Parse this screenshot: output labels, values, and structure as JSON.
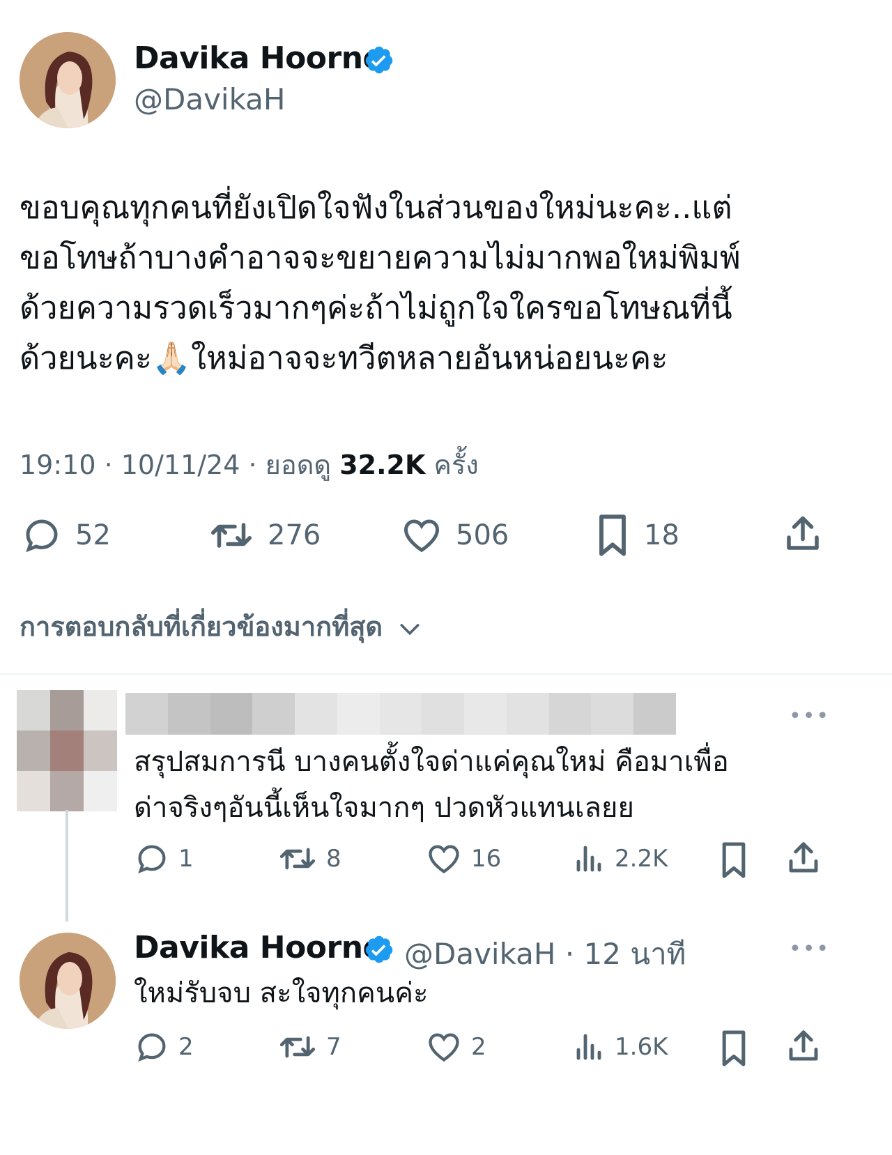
{
  "tweet": {
    "author_name": "Davika Hoorne",
    "author_handle": "@DavikaH",
    "lines": [
      "ขอบคุณทุกคนที่ยังเปิดใจฟังในส่วนของใหม่นะคะ..แต่",
      "ขอโทษถ้าบางคำอาจจะขยายความไม่มากพอใหม่พิมพ์",
      "ด้วยความรวดเร็วมากๆค่ะถ้าไม่ถูกใจใครขอโทษณที่นี้",
      "ด้วยนะคะ🙏🏻ใหม่อาจจะทวีตหลายอันหน่อยนะคะ"
    ],
    "time": "19:10 · 10/11/24 · ยอดดู ",
    "views": "32.2K",
    "views_suffix": " ครั้ง",
    "replies": "52",
    "retweets": "276",
    "likes": "506",
    "bookmarks": "18"
  },
  "sort_label": "การตอบกลับที่เกี่ยวข้องมากที่สุด",
  "reply1": {
    "lines": [
      "สรุปสมการนี บางคนตั้งใจด่าแค่คุณใหม่ คือมาเพื่อ",
      "ด่าจริงๆอันนี้เห็นใจมากๆ ปวดหัวแทนเลยย"
    ],
    "replies": "1",
    "retweets": "8",
    "likes": "16",
    "views": "2.2K"
  },
  "reply2": {
    "author_name": "Davika Hoorne",
    "handle_time": "@DavikaH · 12 นาที",
    "text": "ใหม่รับจบ สะใจทุกคนค่ะ",
    "replies": "2",
    "retweets": "7",
    "likes": "2",
    "views": "1.6K"
  },
  "colors": {
    "text": "#0f1419",
    "secondary": "#536471",
    "verified": "#1d9bf0",
    "divider": "#eff3f4"
  }
}
